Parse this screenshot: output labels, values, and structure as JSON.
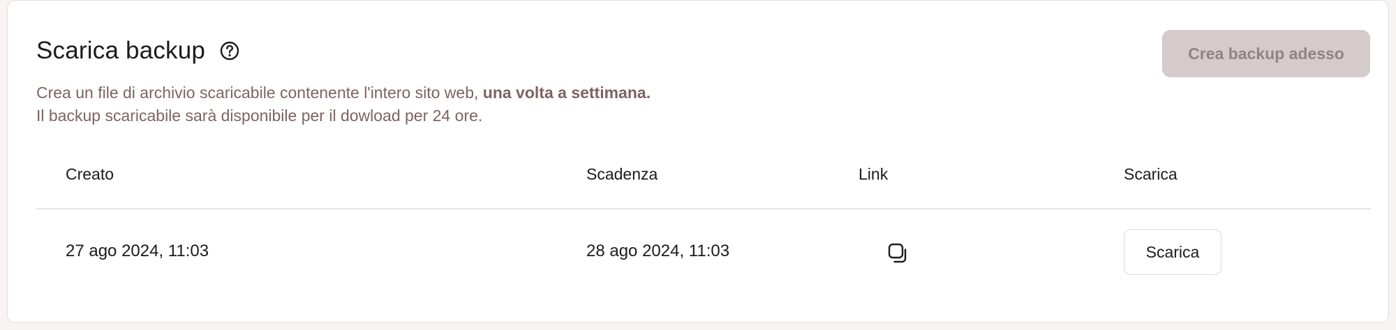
{
  "panel": {
    "title": "Scarica backup",
    "help_icon": "question-circle-icon",
    "create_button_label": "Crea backup adesso",
    "description": {
      "line1_prefix": "Crea un file di archivio scaricabile contenente l'intero sito web,",
      "line1_emphasis": "una volta a settimana.",
      "line2": "Il backup scaricabile sarà disponibile per il dowload per 24 ore."
    }
  },
  "table": {
    "headers": {
      "created": "Creato",
      "expiry": "Scadenza",
      "link": "Link",
      "download": "Scarica"
    },
    "rows": [
      {
        "created": "27 ago 2024, 11:03",
        "expiry": "28 ago 2024, 11:03",
        "link_icon": "copy-icon",
        "download_label": "Scarica"
      }
    ]
  },
  "colors": {
    "page_background": "#f8f4f1",
    "card_background": "#ffffff",
    "muted_text": "#7d6363",
    "disabled_button_bg": "#d5cbcb",
    "disabled_button_text": "#948383"
  }
}
